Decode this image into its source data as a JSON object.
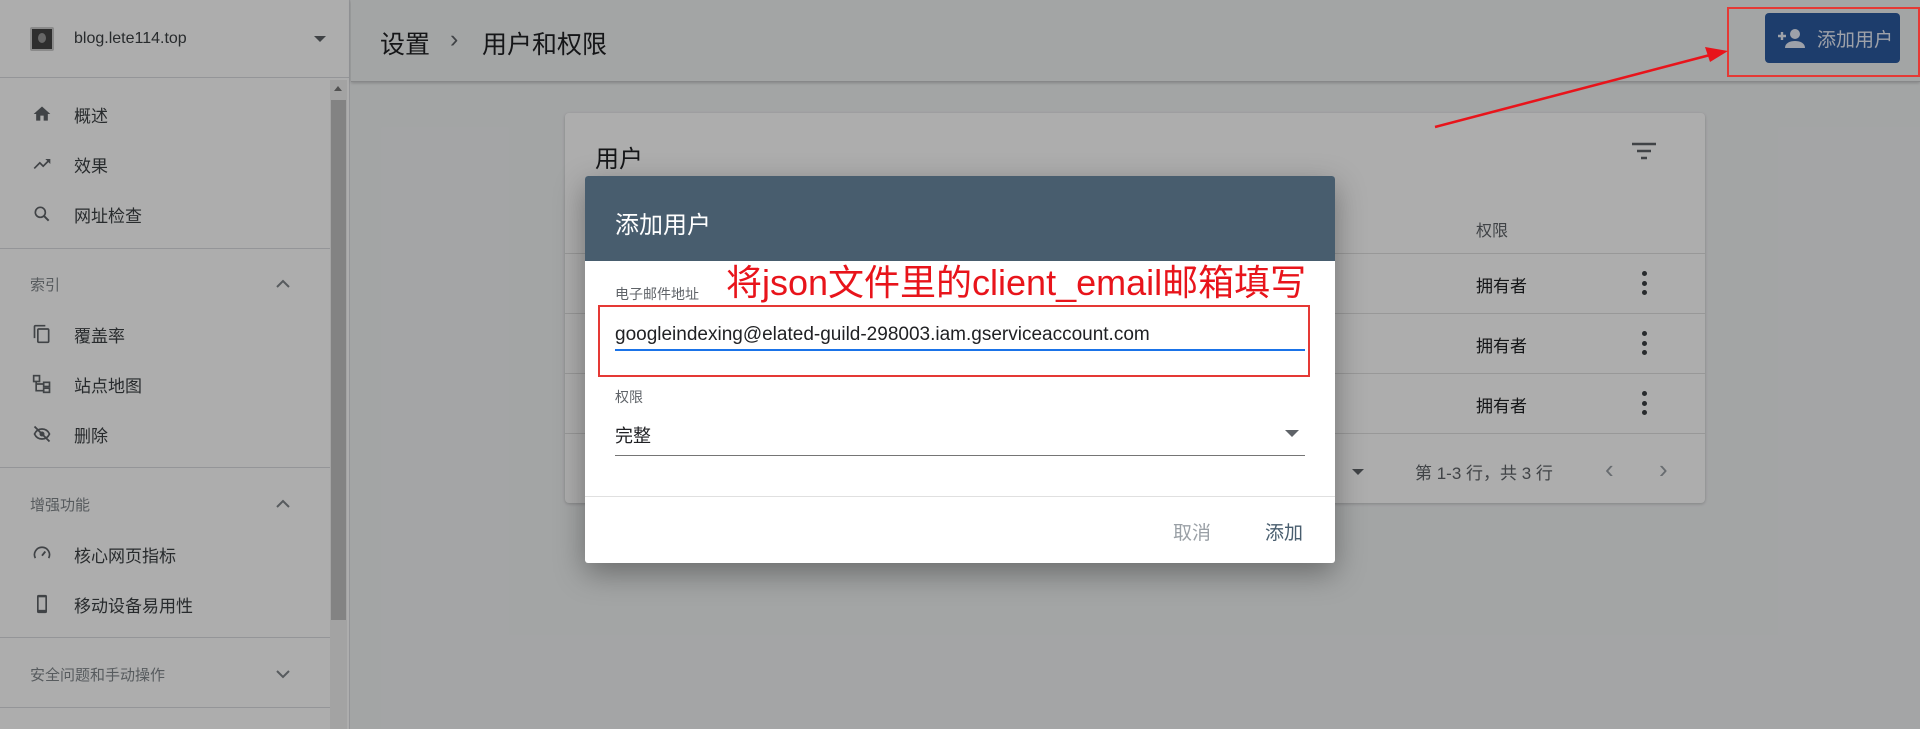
{
  "sidebar": {
    "property_name": "blog.lete114.top",
    "top_items": [
      {
        "label": "概述",
        "icon": "home-icon"
      },
      {
        "label": "效果",
        "icon": "trending-up-icon"
      },
      {
        "label": "网址检查",
        "icon": "search-icon"
      }
    ],
    "index_section": {
      "title": "索引",
      "items": [
        {
          "label": "覆盖率",
          "icon": "copy-icon"
        },
        {
          "label": "站点地图",
          "icon": "sitemap-icon"
        },
        {
          "label": "删除",
          "icon": "visibility-off-icon"
        }
      ]
    },
    "enhance_section": {
      "title": "增强功能",
      "items": [
        {
          "label": "核心网页指标",
          "icon": "speed-icon"
        },
        {
          "label": "移动设备易用性",
          "icon": "phone-icon"
        }
      ]
    },
    "security_section": {
      "title": "安全问题和手动操作"
    }
  },
  "header": {
    "breadcrumb_root": "设置",
    "breadcrumb_sep": "›",
    "breadcrumb_current": "用户和权限",
    "add_user_label": "添加用户"
  },
  "users_card": {
    "title": "用户",
    "permission_header": "权限",
    "rows": [
      {
        "permission": "拥有者"
      },
      {
        "permission": "拥有者"
      },
      {
        "permission": "拥有者"
      }
    ],
    "pagination_text": "第 1-3 行，共 3 行",
    "prev": "‹",
    "next": "›"
  },
  "dialog": {
    "title": "添加用户",
    "email_label": "电子邮件地址",
    "email_value": "googleindexing@elated-guild-298003.iam.gserviceaccount.com",
    "permission_label": "权限",
    "permission_value": "完整",
    "cancel_label": "取消",
    "add_label": "添加"
  },
  "annotation": {
    "text": "将json文件里的client_email邮箱填写",
    "color": "#e8141b"
  },
  "colors": {
    "dialog_header": "#485d6e",
    "primary_button": "#2c5aa0",
    "input_underline": "#1a73e8"
  }
}
